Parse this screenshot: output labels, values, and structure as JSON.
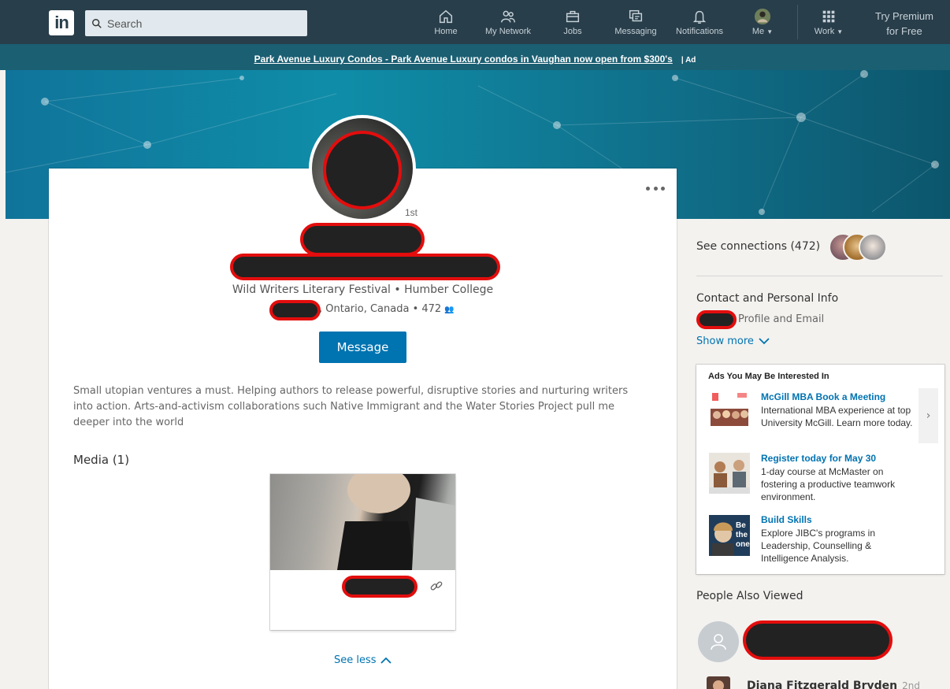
{
  "nav": {
    "search_placeholder": "Search",
    "items": [
      {
        "label": "Home",
        "icon": "home-icon"
      },
      {
        "label": "My Network",
        "icon": "network-icon"
      },
      {
        "label": "Jobs",
        "icon": "briefcase-icon"
      },
      {
        "label": "Messaging",
        "icon": "messaging-icon"
      },
      {
        "label": "Notifications",
        "icon": "bell-icon"
      },
      {
        "label": "Me",
        "icon": "avatar-icon"
      },
      {
        "label": "Work",
        "icon": "grid-icon"
      }
    ],
    "premium_line1": "Try Premium",
    "premium_line2": "for Free",
    "colors": {
      "bar": "#283e4a",
      "accent": "#0073b1"
    }
  },
  "ad_strip": {
    "text": "Park Avenue Luxury Condos - Park Avenue Luxury condos in Vaughan now open from $300's",
    "tag": "| Ad"
  },
  "profile": {
    "degree": "1st",
    "headline": "Wild Writers Literary Festival • Humber College",
    "location": ", Ontario, Canada • 472",
    "message_label": "Message",
    "summary": "Small utopian ventures a must. Helping authors to release powerful, disruptive stories and nurturing writers into action. Arts-and-activism collaborations such Native Immigrant and the Water Stories Project pull me deeper into the world",
    "media_title": "Media (1)",
    "see_less": "See less"
  },
  "sidebar": {
    "see_connections": "See connections (472)",
    "contact_title": "Contact and Personal Info",
    "contact_sub": "Profile and Email",
    "show_more": "Show more",
    "ads_title": "Ads You May Be Interested In",
    "ads": [
      {
        "title": "McGill MBA Book a Meeting",
        "body": "International MBA experience at top University McGill. Learn more today."
      },
      {
        "title": "Register today for May 30",
        "body": "1-day course at McMaster on fostering a productive teamwork environment."
      },
      {
        "title": "Build Skills",
        "body": "Explore JIBC's programs in Leadership, Counselling & Intelligence Analysis."
      }
    ],
    "people_also_viewed": "People Also Viewed",
    "next_person": "Diana Fitzgerald Bryden",
    "next_person_degree": "2nd"
  }
}
